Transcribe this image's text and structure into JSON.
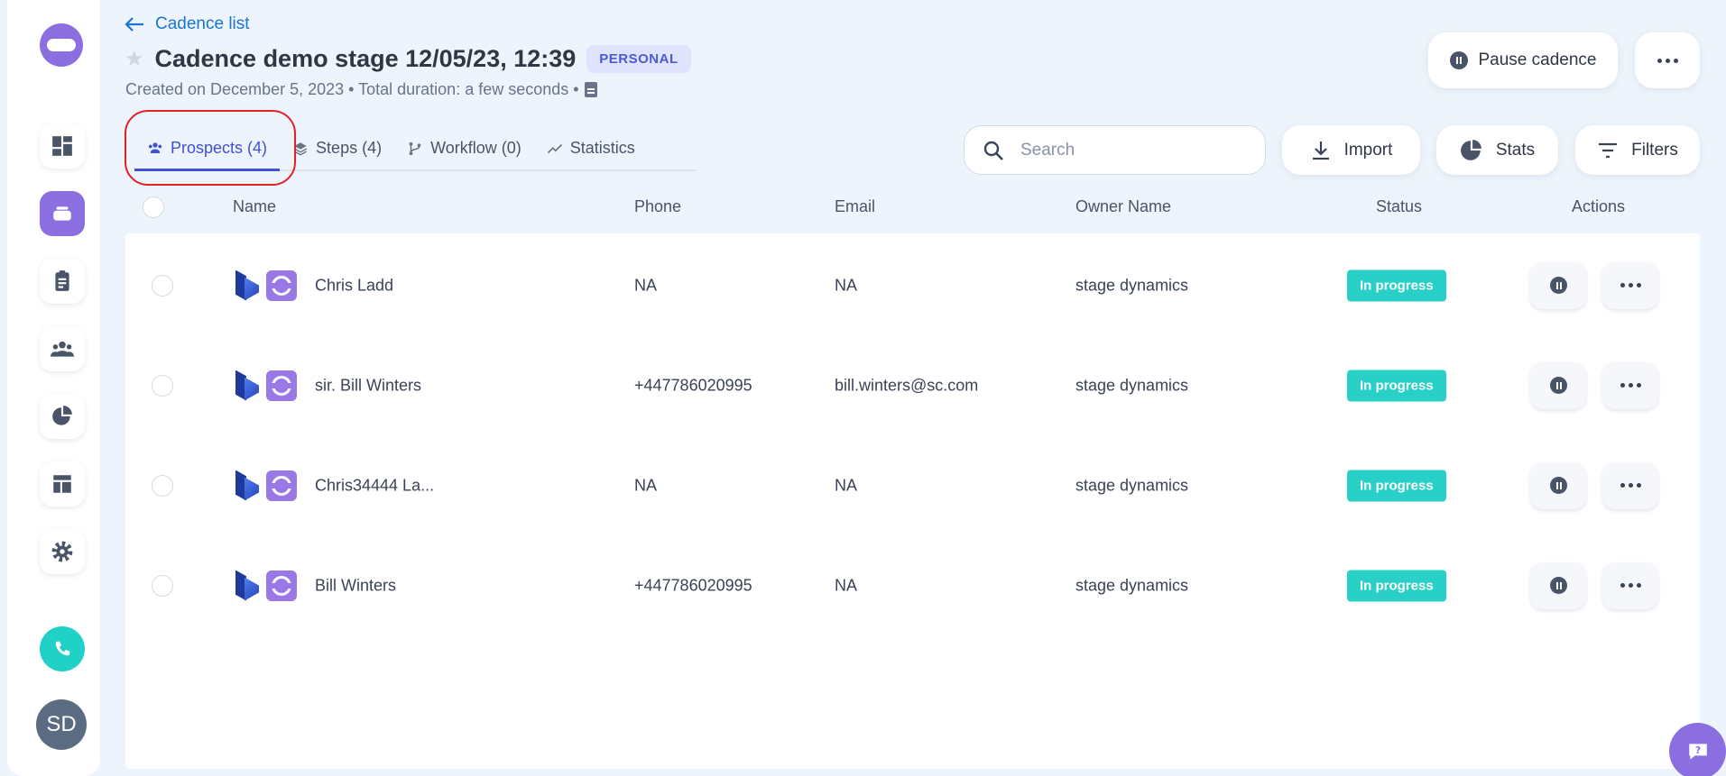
{
  "header": {
    "back_label": "Cadence list",
    "title": "Cadence demo stage 12/05/23, 12:39",
    "badge": "PERSONAL",
    "subtitle": "Created on December 5, 2023 • Total duration: a few seconds •",
    "pause_label": "Pause cadence"
  },
  "sidebar": {
    "items": [
      "dashboard-icon",
      "cadences-icon",
      "tasks-icon",
      "people-icon",
      "reports-icon",
      "templates-icon",
      "settings-icon"
    ],
    "avatar_initials": "SD"
  },
  "tabs": [
    {
      "label": "Prospects (4)",
      "icon": "people-icon"
    },
    {
      "label": "Steps (4)",
      "icon": "layers-icon"
    },
    {
      "label": "Workflow (0)",
      "icon": "workflow-icon"
    },
    {
      "label": "Statistics",
      "icon": "trend-icon"
    }
  ],
  "toolbar": {
    "search_placeholder": "Search",
    "import_label": "Import",
    "stats_label": "Stats",
    "filters_label": "Filters"
  },
  "table": {
    "columns": [
      "Name",
      "Phone",
      "Email",
      "Owner Name",
      "Status",
      "Actions"
    ],
    "rows": [
      {
        "name": "Chris Ladd",
        "phone": "NA",
        "email": "NA",
        "owner": "stage dynamics",
        "status": "In progress"
      },
      {
        "name": "sir. Bill Winters",
        "phone": "+447786020995",
        "email": "bill.winters@sc.com",
        "owner": "stage dynamics",
        "status": "In progress"
      },
      {
        "name": "Chris34444 La...",
        "phone": "NA",
        "email": "NA",
        "owner": "stage dynamics",
        "status": "In progress"
      },
      {
        "name": "Bill Winters",
        "phone": "+447786020995",
        "email": "NA",
        "owner": "stage dynamics",
        "status": "In progress"
      }
    ]
  },
  "colors": {
    "accent": "#3f51d6",
    "brand": "#8b6fe0",
    "status": "#29d0c8",
    "link": "#1976d2"
  }
}
